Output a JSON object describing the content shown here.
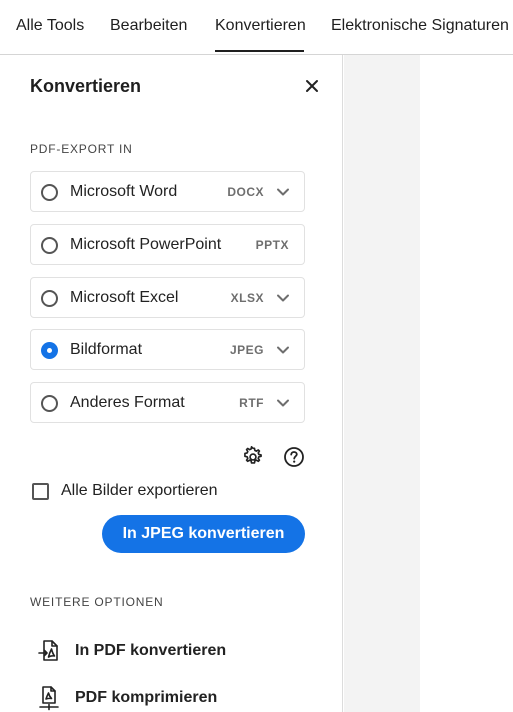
{
  "tabs": [
    {
      "label": "Alle Tools"
    },
    {
      "label": "Bearbeiten"
    },
    {
      "label": "Konvertieren",
      "active": true
    },
    {
      "label": "Elektronische Signaturen"
    }
  ],
  "panel": {
    "title": "Konvertieren",
    "close_icon": "close-icon",
    "export_section_label": "PDF-EXPORT IN",
    "options": [
      {
        "label": "Microsoft Word",
        "format": "DOCX",
        "has_dropdown": true,
        "selected": false
      },
      {
        "label": "Microsoft PowerPoint",
        "format": "PPTX",
        "has_dropdown": false,
        "selected": false
      },
      {
        "label": "Microsoft Excel",
        "format": "XLSX",
        "has_dropdown": true,
        "selected": false
      },
      {
        "label": "Bildformat",
        "format": "JPEG",
        "has_dropdown": true,
        "selected": true
      },
      {
        "label": "Anderes Format",
        "format": "RTF",
        "has_dropdown": true,
        "selected": false
      }
    ],
    "settings_icon": "gear-icon",
    "help_icon": "help-icon",
    "checkbox": {
      "label": "Alle Bilder exportieren",
      "checked": false
    },
    "convert_button": "In JPEG konvertieren",
    "more_section_label": "WEITERE OPTIONEN",
    "more_options": [
      {
        "label": "In PDF konvertieren",
        "icon": "convert-to-pdf-icon"
      },
      {
        "label": "PDF komprimieren",
        "icon": "compress-pdf-icon"
      }
    ]
  },
  "colors": {
    "accent": "#1473e6",
    "text": "#222222",
    "border": "#e1e1e1",
    "canvas": "#f3f3f3"
  }
}
